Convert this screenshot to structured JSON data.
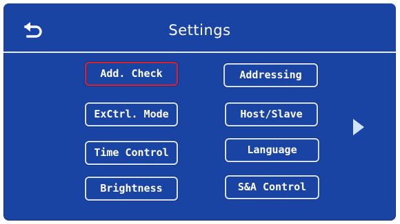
{
  "header": {
    "title": "Settings"
  },
  "icons": {
    "back": "back-arrow-icon",
    "next": "right-triangle-icon"
  },
  "colors": {
    "background": "#1a44a3",
    "button_border": "#d7e2f5",
    "selected_border": "#d8213b",
    "text": "#ffffff"
  },
  "buttons": {
    "add_check": "Add. Check",
    "addressing": "Addressing",
    "exctrl_mode": "ExCtrl. Mode",
    "host_slave": "Host/Slave",
    "time_control": "Time Control",
    "language": "Language",
    "brightness": "Brightness",
    "sa_control": "S&A Control"
  },
  "selected": "Add. Check"
}
